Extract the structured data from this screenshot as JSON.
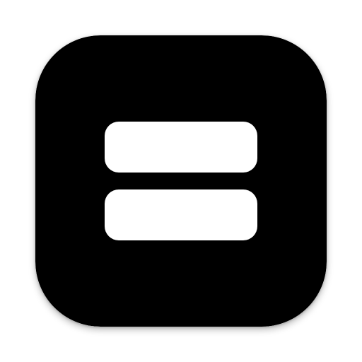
{
  "app_icon": {
    "icon_name": "equals-sign-app-icon",
    "glyph_name": "equals-icon",
    "colors": {
      "background": "#ffffff",
      "tile": "#000000",
      "glyph": "#ffffff"
    }
  }
}
